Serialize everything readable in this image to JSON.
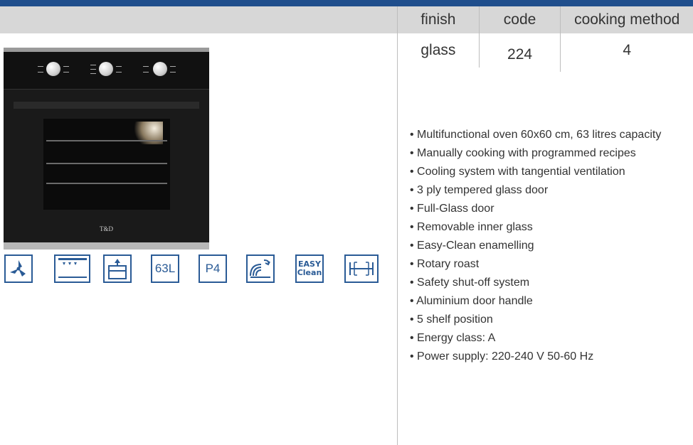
{
  "spec_table": {
    "headers": [
      "finish",
      "code",
      "cooking method"
    ],
    "values": [
      "glass",
      "224",
      "4"
    ]
  },
  "features": [
    "Multifunctional oven 60x60 cm, 63 litres capacity",
    "Manually cooking with programmed recipes",
    "Cooling system with tangential ventilation",
    "3 ply tempered glass door",
    "Full-Glass door",
    "Removable inner glass",
    "Easy-Clean enamelling",
    "Rotary roast",
    "Safety shut-off system",
    "Aluminium door handle",
    "5 shelf position",
    "Energy class: A",
    "Power supply: 220-240 V 50-60 Hz"
  ],
  "oven": {
    "brand": "T&D"
  },
  "icons": {
    "capacity": "63L",
    "programs": "P4",
    "easy_clean_line1": "EASY",
    "easy_clean_line2": "Clean"
  },
  "colors": {
    "accent": "#1f4e8c",
    "icon_blue": "#2a5b96",
    "header_gray": "#d7d7d7"
  }
}
